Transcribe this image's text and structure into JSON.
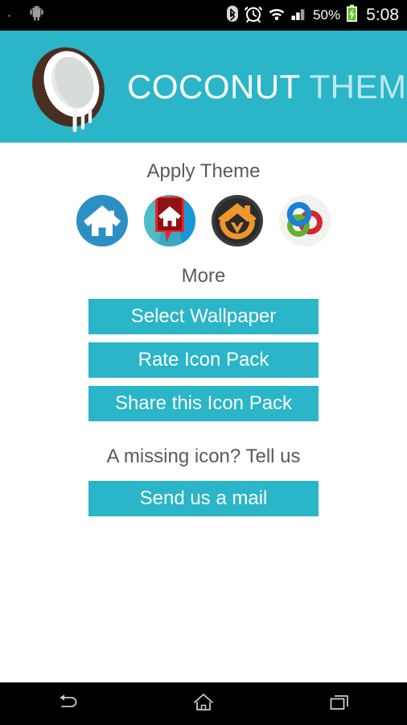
{
  "status_bar": {
    "notification_icon": "android-robot-icon",
    "icons": [
      "bluetooth-icon",
      "alarm-clock-icon",
      "wifi-icon",
      "cell-signal-icon"
    ],
    "battery_percent": "50%",
    "battery_icon": "battery-charging-icon",
    "clock": "5:08",
    "background_color": "#000000"
  },
  "header": {
    "logo_icon": "coconut-logo-icon",
    "title_bold": "COCONUT",
    "title_light": " THEME",
    "background_color": "#2ab5c8",
    "text_color": "#ffffff"
  },
  "main": {
    "apply_theme_label": "Apply Theme",
    "launchers": [
      {
        "name": "nova-launcher-icon",
        "label": "Nova Launcher"
      },
      {
        "name": "apex-launcher-icon",
        "label": "Apex Launcher"
      },
      {
        "name": "adw-launcher-icon",
        "label": "ADW Launcher"
      },
      {
        "name": "go-launcher-icon",
        "label": "Go Launcher"
      }
    ],
    "more_label": "More",
    "buttons": [
      {
        "name": "select-wallpaper-button",
        "label": "Select Wallpaper"
      },
      {
        "name": "rate-icon-pack-button",
        "label": "Rate Icon Pack"
      },
      {
        "name": "share-icon-pack-button",
        "label": "Share this Icon Pack"
      }
    ],
    "missing_icon_label": "A missing icon? Tell us",
    "mail_button_label": "Send us a mail",
    "accent_color": "#2ab5c8",
    "label_color": "#5a5a5a",
    "background_color": "#ffffff"
  },
  "nav_bar": {
    "buttons": [
      {
        "name": "nav-back-button",
        "icon": "back-arrow-icon"
      },
      {
        "name": "nav-home-button",
        "icon": "home-outline-icon"
      },
      {
        "name": "nav-recents-button",
        "icon": "recents-square-icon"
      }
    ],
    "background_color": "#000000"
  }
}
